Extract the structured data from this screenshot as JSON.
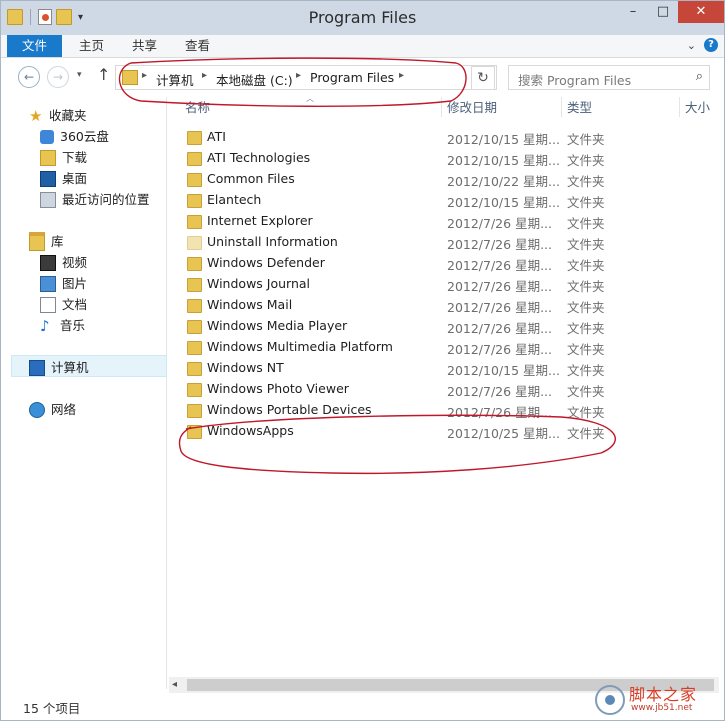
{
  "window": {
    "title": "Program Files"
  },
  "ribbon": {
    "tabs": [
      "文件",
      "主页",
      "共享",
      "查看"
    ]
  },
  "address": {
    "crumbs": [
      "计算机",
      "本地磁盘 (C:)",
      "Program Files"
    ]
  },
  "search": {
    "placeholder": "搜索 Program Files"
  },
  "sidebar": {
    "favorites": {
      "title": "收藏夹",
      "items": [
        "360云盘",
        "下载",
        "桌面",
        "最近访问的位置"
      ]
    },
    "libraries": {
      "title": "库",
      "items": [
        "视频",
        "图片",
        "文档",
        "音乐"
      ]
    },
    "computer": "计算机",
    "network": "网络"
  },
  "columns": {
    "name": "名称",
    "date": "修改日期",
    "type": "类型",
    "size": "大小"
  },
  "files": [
    {
      "name": "ATI",
      "date": "2012/10/15 星期...",
      "type": "文件夹"
    },
    {
      "name": "ATI Technologies",
      "date": "2012/10/15 星期...",
      "type": "文件夹"
    },
    {
      "name": "Common Files",
      "date": "2012/10/22 星期...",
      "type": "文件夹"
    },
    {
      "name": "Elantech",
      "date": "2012/10/15 星期...",
      "type": "文件夹"
    },
    {
      "name": "Internet Explorer",
      "date": "2012/7/26 星期...",
      "type": "文件夹"
    },
    {
      "name": "Uninstall Information",
      "date": "2012/7/26 星期...",
      "type": "文件夹"
    },
    {
      "name": "Windows Defender",
      "date": "2012/7/26 星期...",
      "type": "文件夹"
    },
    {
      "name": "Windows Journal",
      "date": "2012/7/26 星期...",
      "type": "文件夹"
    },
    {
      "name": "Windows Mail",
      "date": "2012/7/26 星期...",
      "type": "文件夹"
    },
    {
      "name": "Windows Media Player",
      "date": "2012/7/26 星期...",
      "type": "文件夹"
    },
    {
      "name": "Windows Multimedia Platform",
      "date": "2012/7/26 星期...",
      "type": "文件夹"
    },
    {
      "name": "Windows NT",
      "date": "2012/10/15 星期...",
      "type": "文件夹"
    },
    {
      "name": "Windows Photo Viewer",
      "date": "2012/7/26 星期...",
      "type": "文件夹"
    },
    {
      "name": "Windows Portable Devices",
      "date": "2012/7/26 星期...",
      "type": "文件夹"
    },
    {
      "name": "WindowsApps",
      "date": "2012/10/25 星期...",
      "type": "文件夹"
    }
  ],
  "status": {
    "count": "15 个项目"
  },
  "watermark": {
    "line1": "脚本之家",
    "line2": "www.jb51.net"
  },
  "colors": {
    "accent": "#1979ca",
    "annotation": "#c0182a",
    "folder": "#e8c452"
  }
}
